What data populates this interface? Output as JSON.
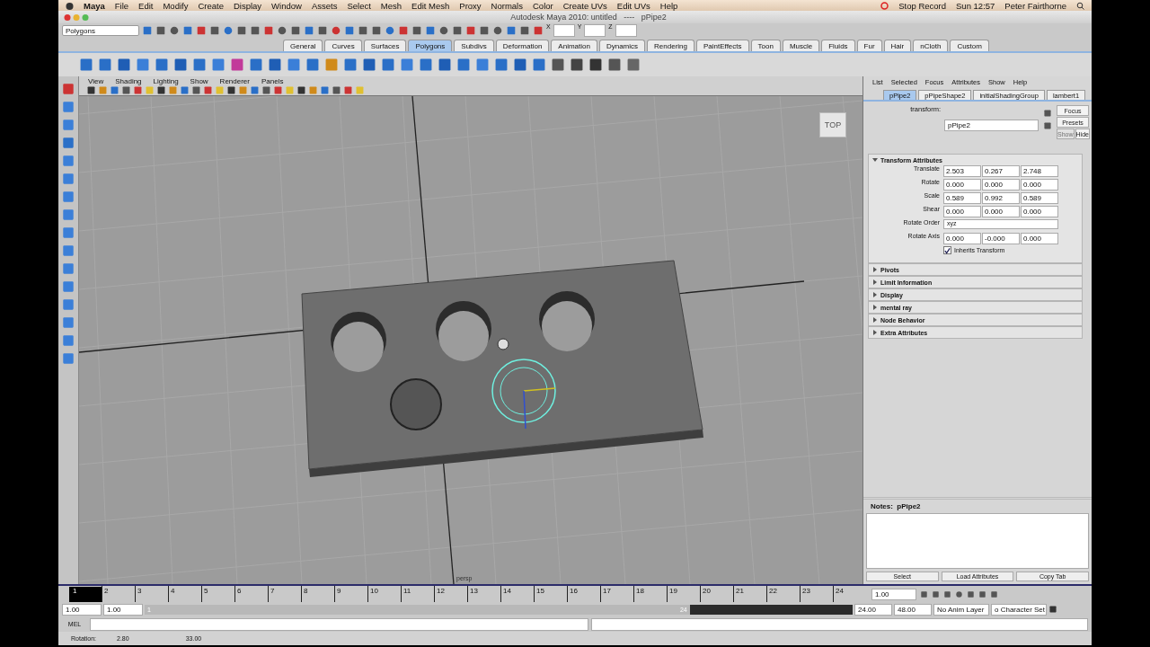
{
  "menubar": {
    "app": "Maya",
    "items": [
      "File",
      "Edit",
      "Modify",
      "Create",
      "Display",
      "Window",
      "Assets",
      "Select",
      "Mesh",
      "Edit Mesh",
      "Proxy",
      "Normals",
      "Color",
      "Create UVs",
      "Edit UVs",
      "Help"
    ],
    "status": [
      "Stop Record",
      "Sun 12:57",
      "Peter Fairthorne"
    ]
  },
  "window": {
    "title": "Autodesk Maya 2010: untitled   ----   pPipe2"
  },
  "status_line": {
    "mode": "Polygons",
    "fields": [
      {
        "label": "X"
      },
      {
        "label": "Y"
      },
      {
        "label": "Z"
      }
    ]
  },
  "shelf": {
    "tabs": [
      {
        "label": "General",
        "selected": false
      },
      {
        "label": "Curves",
        "selected": false
      },
      {
        "label": "Surfaces",
        "selected": false
      },
      {
        "label": "Polygons",
        "selected": true
      },
      {
        "label": "Subdivs",
        "selected": false
      },
      {
        "label": "Deformation",
        "selected": false
      },
      {
        "label": "Animation",
        "selected": false
      },
      {
        "label": "Dynamics",
        "selected": false
      },
      {
        "label": "Rendering",
        "selected": false
      },
      {
        "label": "PaintEffects",
        "selected": false
      },
      {
        "label": "Toon",
        "selected": false
      },
      {
        "label": "Muscle",
        "selected": false
      },
      {
        "label": "Fluids",
        "selected": false
      },
      {
        "label": "Fur",
        "selected": false
      },
      {
        "label": "Hair",
        "selected": false
      },
      {
        "label": "nCloth",
        "selected": false
      },
      {
        "label": "Custom",
        "selected": false
      }
    ]
  },
  "viewport": {
    "menu": [
      "View",
      "Shading",
      "Lighting",
      "Show",
      "Renderer",
      "Panels"
    ],
    "camera": "persp",
    "viewcube": "TOP"
  },
  "attribute_editor": {
    "menu": [
      "List",
      "Selected",
      "Focus",
      "Attributes",
      "Show",
      "Help"
    ],
    "tabs": [
      {
        "label": "pPipe2",
        "selected": true
      },
      {
        "label": "pPipeShape2",
        "selected": false
      },
      {
        "label": "initialShadingGroup",
        "selected": false
      },
      {
        "label": "lambert1",
        "selected": false
      }
    ],
    "node_type": "transform:",
    "node_name": "pPipe2",
    "side_buttons": [
      {
        "label": "Focus",
        "disabled": false
      },
      {
        "label": "Presets",
        "disabled": false
      }
    ],
    "show_hide": [
      {
        "label": "Show",
        "disabled": true
      },
      {
        "label": "Hide",
        "disabled": false
      }
    ],
    "sections": [
      {
        "title": "Transform Attributes",
        "expanded": true
      },
      {
        "title": "Pivots",
        "expanded": false
      },
      {
        "title": "Limit Information",
        "expanded": false
      },
      {
        "title": "Display",
        "expanded": false
      },
      {
        "title": "mental ray",
        "expanded": false
      },
      {
        "title": "Node Behavior",
        "expanded": false
      },
      {
        "title": "Extra Attributes",
        "expanded": false
      }
    ],
    "attributes": [
      {
        "label": "Translate",
        "kind": "vector",
        "values": [
          "2.503",
          "0.267",
          "2.748"
        ]
      },
      {
        "label": "Rotate",
        "kind": "vector",
        "values": [
          "0.000",
          "0.000",
          "0.000"
        ]
      },
      {
        "label": "Scale",
        "kind": "vector",
        "values": [
          "0.589",
          "0.992",
          "0.589"
        ]
      },
      {
        "label": "Shear",
        "kind": "vector",
        "values": [
          "0.000",
          "0.000",
          "0.000"
        ]
      },
      {
        "label": "Rotate Order",
        "kind": "dropdown",
        "value": "xyz"
      },
      {
        "label": "Rotate Axis",
        "kind": "vector",
        "values": [
          "0.000",
          "-0.000",
          "0.000"
        ]
      },
      {
        "label": "Inherits Transform",
        "kind": "checkbox",
        "checked": true
      }
    ],
    "notes": "Notes:  pPipe2",
    "footer_buttons": [
      "Select",
      "Load Attributes",
      "Copy Tab"
    ]
  },
  "timeline": {
    "ticks": [
      {
        "label": "1",
        "selected": true
      },
      {
        "label": "2",
        "selected": false
      },
      {
        "label": "3",
        "selected": false
      },
      {
        "label": "4",
        "selected": false
      },
      {
        "label": "5",
        "selected": false
      },
      {
        "label": "6",
        "selected": false
      },
      {
        "label": "7",
        "selected": false
      },
      {
        "label": "8",
        "selected": false
      },
      {
        "label": "9",
        "selected": false
      },
      {
        "label": "10",
        "selected": false
      },
      {
        "label": "11",
        "selected": false
      },
      {
        "label": "12",
        "selected": false
      },
      {
        "label": "13",
        "selected": false
      },
      {
        "label": "14",
        "selected": false
      },
      {
        "label": "15",
        "selected": false
      },
      {
        "label": "16",
        "selected": false
      },
      {
        "label": "17",
        "selected": false
      },
      {
        "label": "18",
        "selected": false
      },
      {
        "label": "19",
        "selected": false
      },
      {
        "label": "20",
        "selected": false
      },
      {
        "label": "21",
        "selected": false
      },
      {
        "label": "22",
        "selected": false
      },
      {
        "label": "23",
        "selected": false
      },
      {
        "label": "24",
        "selected": false
      }
    ],
    "current_frame": "1.00"
  },
  "range": {
    "start": "1.00",
    "inner_start": "1.00",
    "handle_start": "1",
    "handle_end": "24",
    "inner_end": "24.00",
    "end": "48.00",
    "level": 0.77,
    "anim_layer": "No Anim Layer",
    "character_set": "o Character Set"
  },
  "command_line": {
    "label": "MEL"
  },
  "help_line": [
    "Rotation:",
    "2.80",
    "33.00"
  ]
}
